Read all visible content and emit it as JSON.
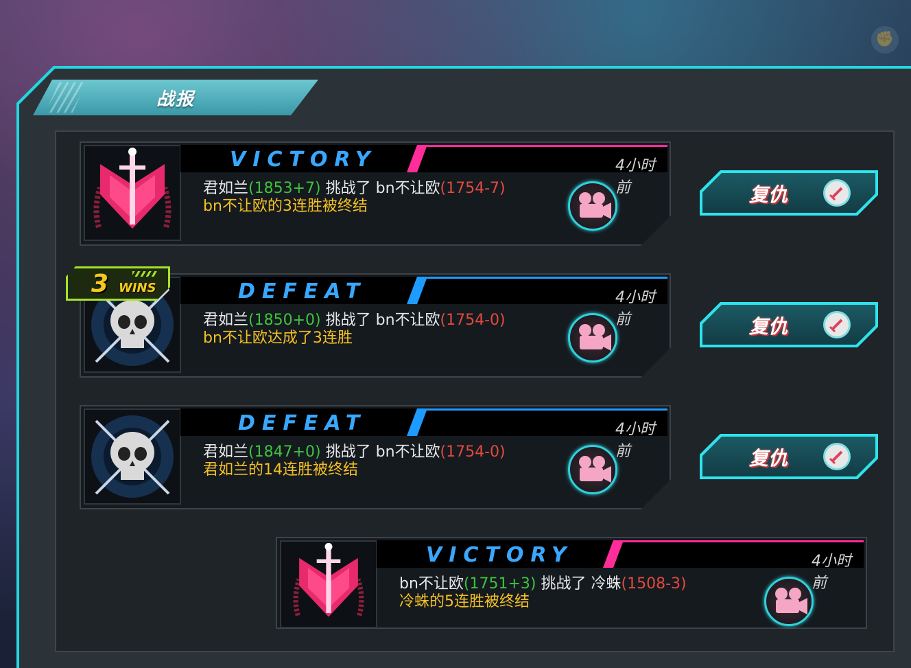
{
  "header": {
    "title": "战报"
  },
  "wins_badge": {
    "count": "3",
    "label": "WINS"
  },
  "records": [
    {
      "result": "VICTORY",
      "result_color": "#3aa7ff",
      "accent_color": "#ff2d9a",
      "time": "4小时前",
      "attacker": "君如兰",
      "attacker_rating": "(1853+7)",
      "verb": " 挑战了 ",
      "defender": "bn不让欧",
      "defender_rating": "(1754-7)",
      "note": "bn不让欧的3连胜被终结",
      "emblem": "victory-emblem",
      "revenge_label": "复仇"
    },
    {
      "result": "DEFEAT",
      "result_color": "#3aa7ff",
      "accent_color": "#1e9bff",
      "time": "4小时前",
      "attacker": "君如兰",
      "attacker_rating": "(1850+0)",
      "verb": " 挑战了 ",
      "defender": "bn不让欧",
      "defender_rating": "(1754-0)",
      "note": "bn不让欧达成了3连胜",
      "emblem": "skull-emblem",
      "revenge_label": "复仇"
    },
    {
      "result": "DEFEAT",
      "result_color": "#3aa7ff",
      "accent_color": "#1e9bff",
      "time": "4小时前",
      "attacker": "君如兰",
      "attacker_rating": "(1847+0)",
      "verb": " 挑战了 ",
      "defender": "bn不让欧",
      "defender_rating": "(1754-0)",
      "note": "君如兰的14连胜被终结",
      "emblem": "skull-emblem",
      "revenge_label": "复仇"
    },
    {
      "result": "VICTORY",
      "result_color": "#3aa7ff",
      "accent_color": "#ff2d9a",
      "time": "4小时前",
      "attacker": "bn不让欧",
      "attacker_rating": "(1751+3)",
      "verb": " 挑战了 ",
      "defender": "冷蛛",
      "defender_rating": "(1508-3)",
      "note": "冷蛛的5连胜被终结",
      "emblem": "victory-emblem"
    }
  ],
  "icons": {
    "replay": "video-camera-icon",
    "revenge": "sword-icon",
    "corner": "fist-icon"
  }
}
